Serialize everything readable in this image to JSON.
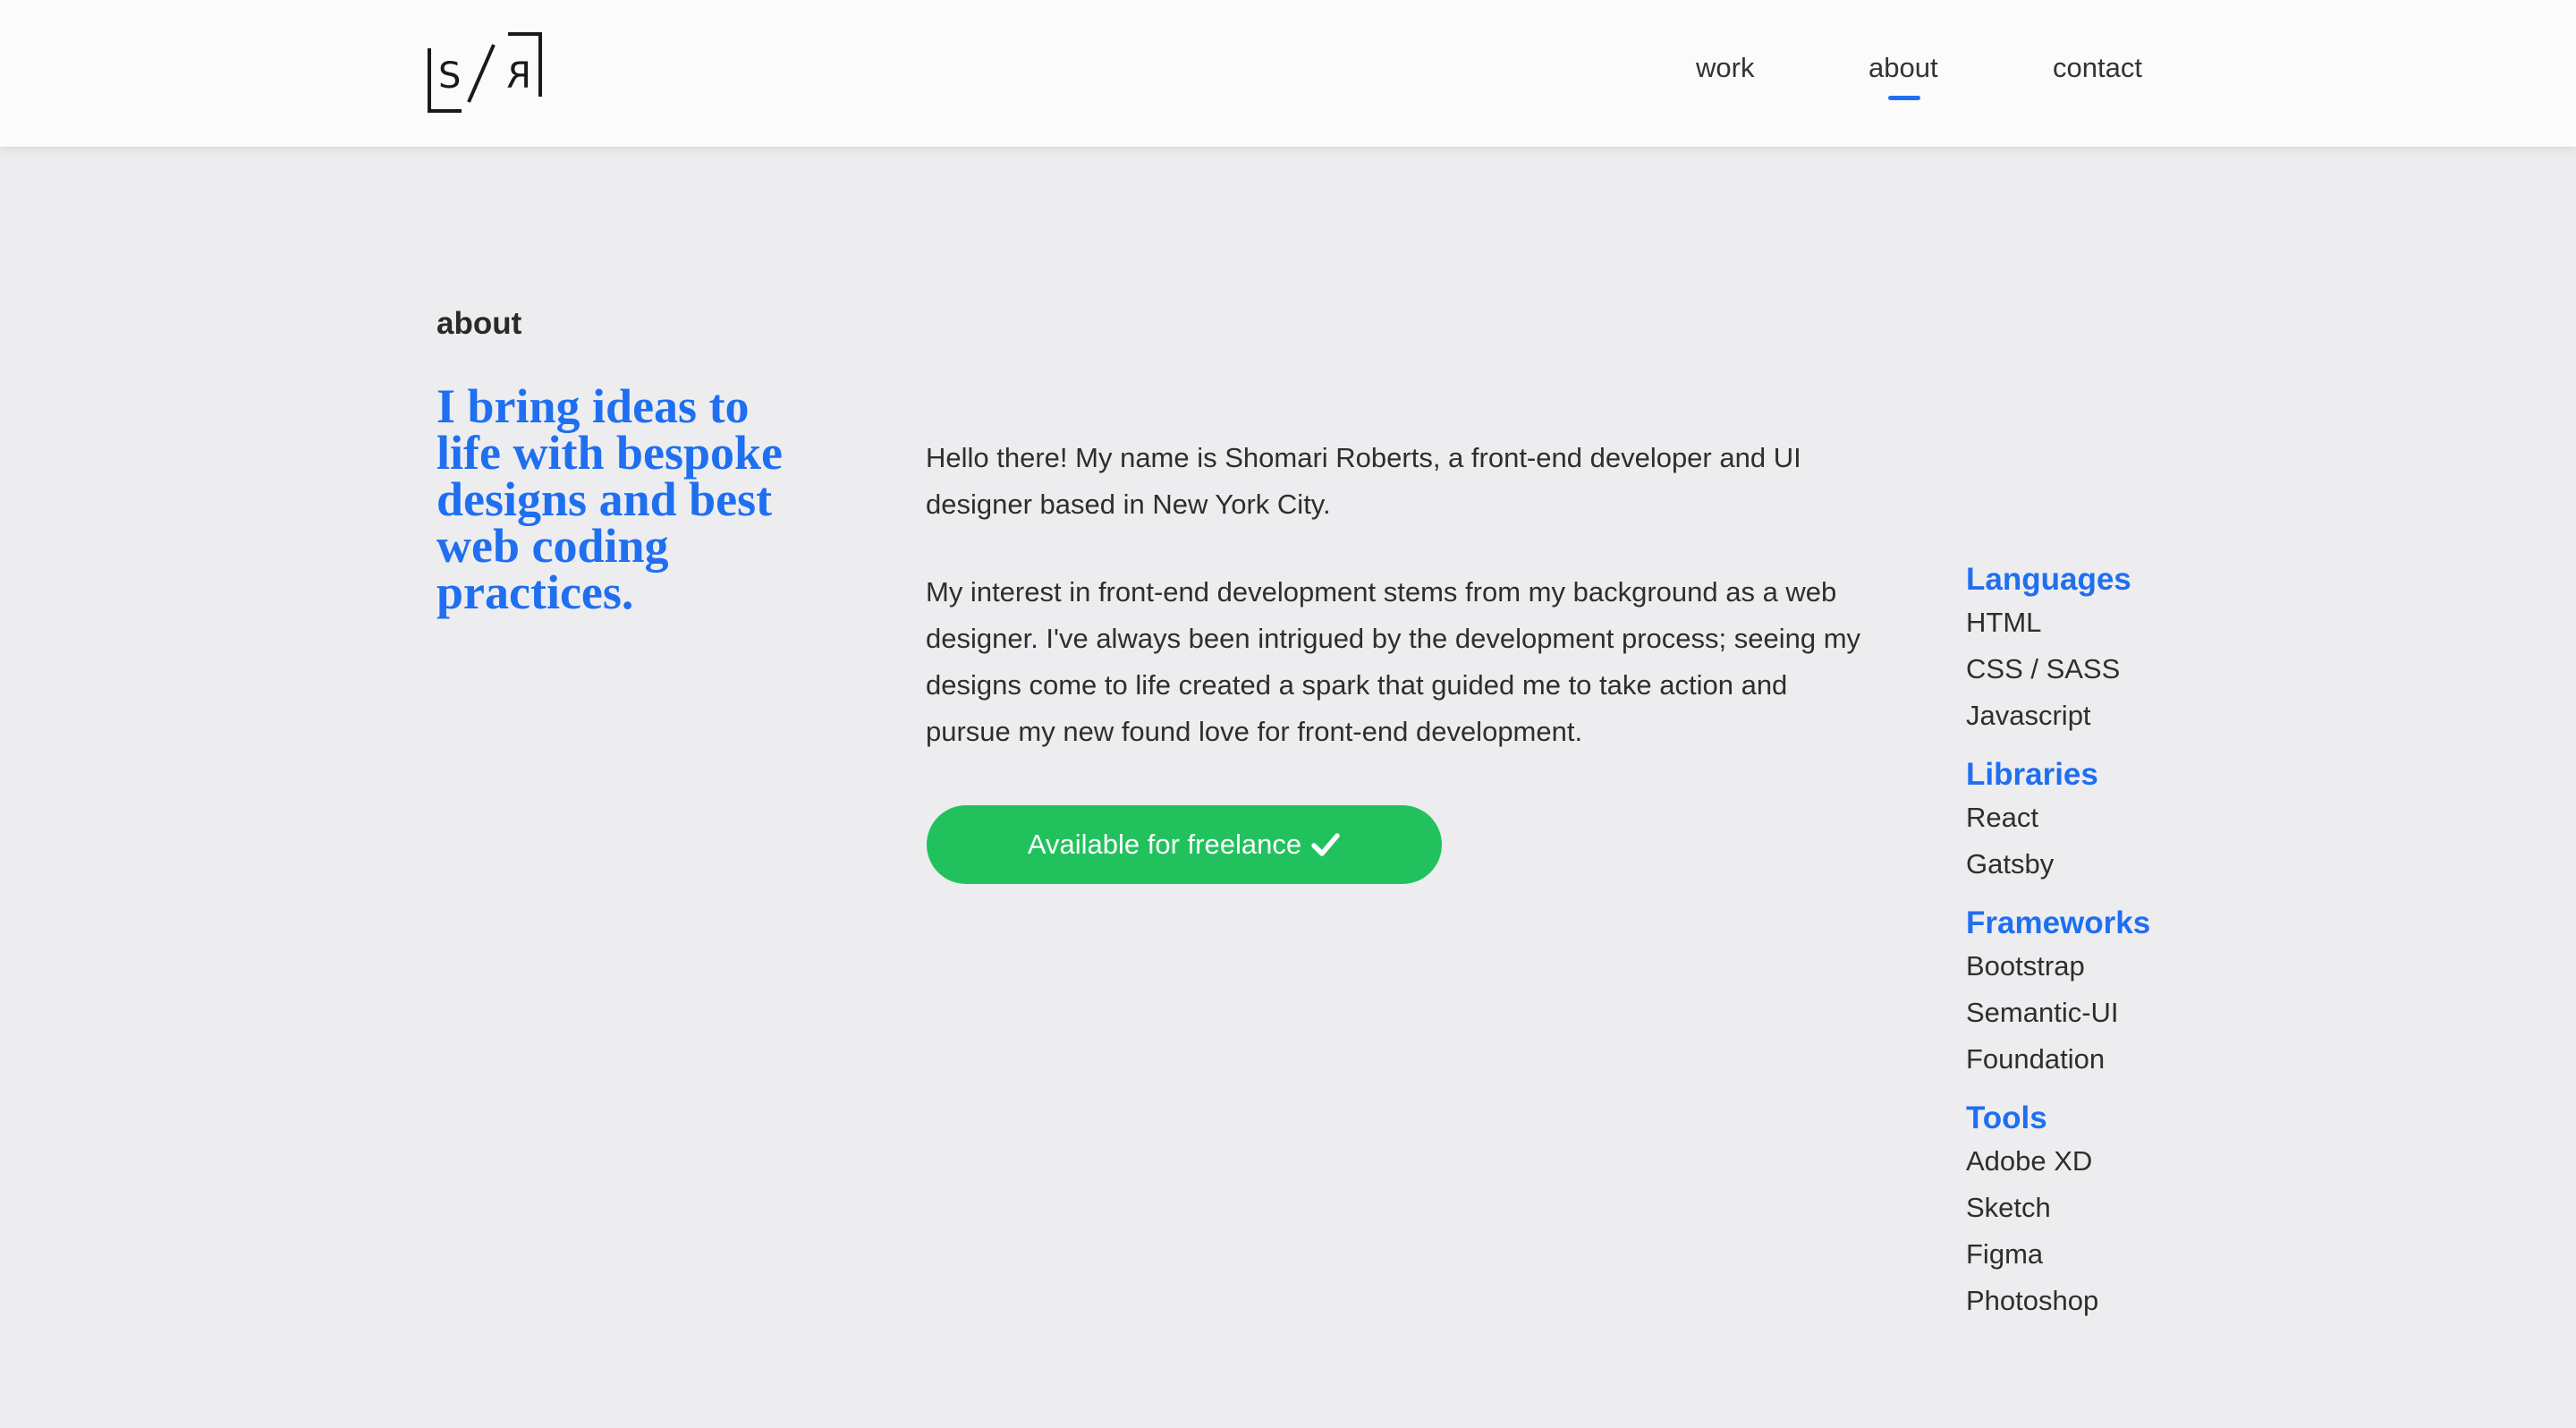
{
  "header": {
    "logo_text": "S/R",
    "nav": {
      "work": "work",
      "about": "about",
      "contact": "contact"
    },
    "active_nav": "about"
  },
  "main": {
    "section_label": "about",
    "tagline": "I bring ideas to life with bespoke designs and best web coding practices.",
    "bio_paragraph_1": "Hello there! My name is Shomari Roberts, a front-end developer and UI designer based in New York City.",
    "bio_paragraph_2": "My interest in front-end development stems from my background as a web designer. I've always been intrigued by the development process; seeing my designs come to life created a spark that guided me to take action and pursue my new found love for front-end development.",
    "freelance_button": "Available for freelance",
    "freelance_icon": "check-icon"
  },
  "skills": [
    {
      "title": "Languages",
      "items": [
        "HTML",
        "CSS / SASS",
        "Javascript"
      ]
    },
    {
      "title": "Libraries",
      "items": [
        "React",
        "Gatsby"
      ]
    },
    {
      "title": "Frameworks",
      "items": [
        "Bootstrap",
        "Semantic-UI",
        "Foundation"
      ]
    },
    {
      "title": "Tools",
      "items": [
        "Adobe XD",
        "Sketch",
        "Figma",
        "Photoshop"
      ]
    }
  ],
  "colors": {
    "accent": "#1f6ff0",
    "button": "#21c25d",
    "background": "#ededf0",
    "header": "#fbfbfb"
  }
}
